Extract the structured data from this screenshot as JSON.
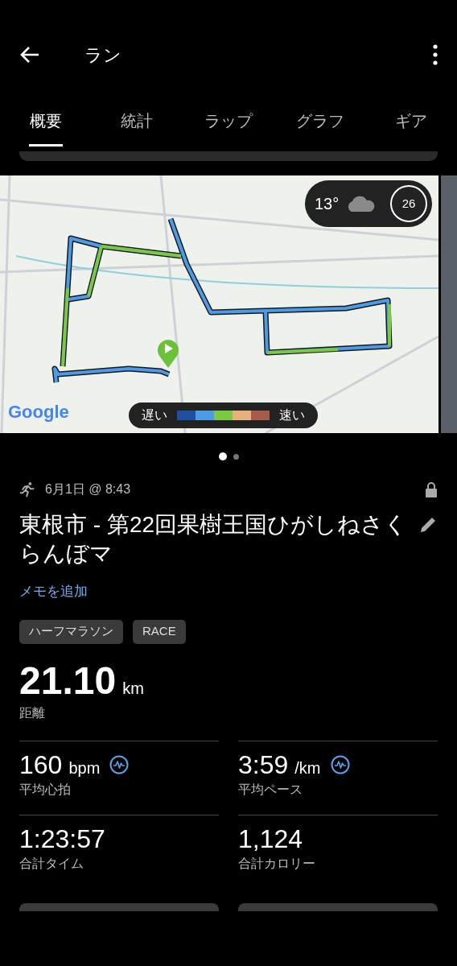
{
  "header": {
    "title": "ラン"
  },
  "tabs": [
    {
      "label": "概要",
      "selected": true
    },
    {
      "label": "統計",
      "selected": false
    },
    {
      "label": "ラップ",
      "selected": false
    },
    {
      "label": "グラフ",
      "selected": false
    },
    {
      "label": "ギア",
      "selected": false
    }
  ],
  "map": {
    "weather": {
      "temperature": "13°",
      "wind": "26"
    },
    "legend": {
      "slow": "遅い",
      "fast": "速い"
    },
    "logo": "Google"
  },
  "page_dots": [
    {
      "selected": true
    },
    {
      "selected": false
    }
  ],
  "activity": {
    "date": "6月1日 @ 8:43",
    "title": "東根市 - 第22回果樹王国ひがしねさくらんぼマ",
    "add_note": "メモを追加",
    "tags": [
      "ハーフマラソン",
      "RACE"
    ]
  },
  "distance": {
    "value": "21.10",
    "unit": "km",
    "label": "距離"
  },
  "stats": [
    {
      "value": "160",
      "unit": "bpm",
      "label": "平均心拍",
      "chart_link": true
    },
    {
      "value": "3:59",
      "unit": "/km",
      "label": "平均ペース",
      "chart_link": true
    },
    {
      "value": "1:23:57",
      "label": "合計タイム",
      "chart_link": false
    },
    {
      "value": "1,124",
      "label": "合計カロリー",
      "chart_link": false
    }
  ]
}
